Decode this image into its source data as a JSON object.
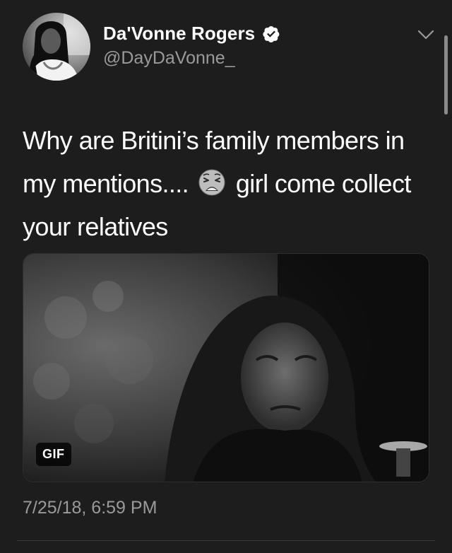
{
  "tweet": {
    "author": {
      "display_name": "Da'Vonne Rogers",
      "handle": "@DayDaVonne_",
      "verified": true,
      "verified_icon": "verified-badge-icon",
      "avatar_icon": "profile-photo"
    },
    "menu_icon": "chevron-down-icon",
    "text_part_1": "Why are Britini’s family members in my mentions....",
    "emoji_icon": "weary-face-emoji",
    "text_part_2": "girl come collect your relatives",
    "media": {
      "type": "gif",
      "badge_label": "GIF"
    },
    "timestamp": "7/25/18, 6:59 PM"
  },
  "colors": {
    "background": "#1d1d1d",
    "primary_text": "#ffffff",
    "secondary_text": "#9a9a9a",
    "divider": "#3a3a3a"
  }
}
